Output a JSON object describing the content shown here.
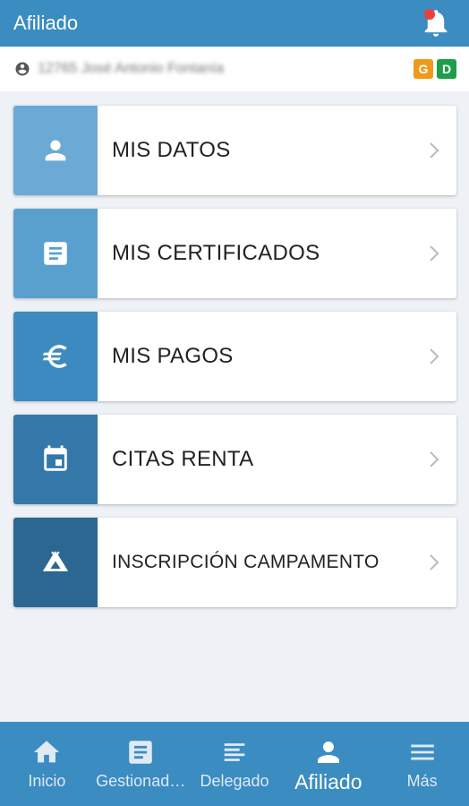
{
  "appbar": {
    "title": "Afiliado"
  },
  "user": {
    "name": "12765 José Antonio Fontanía",
    "badges": [
      "G",
      "D"
    ]
  },
  "menu": [
    {
      "label": "MIS DATOS",
      "icon": "person-icon",
      "color": "#6baad4"
    },
    {
      "label": "MIS CERTIFICADOS",
      "icon": "document-icon",
      "color": "#5aa0cf"
    },
    {
      "label": "MIS PAGOS",
      "icon": "euro-icon",
      "color": "#3d8ac0"
    },
    {
      "label": "CITAS RENTA",
      "icon": "calendar-icon",
      "color": "#3378a9"
    },
    {
      "label": "INSCRIPCIÓN CAMPAMENTO",
      "icon": "tent-icon",
      "color": "#2c6791"
    }
  ],
  "nav": [
    {
      "label": "Inicio",
      "icon": "home-icon"
    },
    {
      "label": "Gestionad…",
      "icon": "document-icon"
    },
    {
      "label": "Delegado",
      "icon": "lines-icon"
    },
    {
      "label": "Afiliado",
      "icon": "person-icon",
      "active": true
    },
    {
      "label": "Más",
      "icon": "menu-icon"
    }
  ],
  "colors": {
    "primary": "#3a8cc1",
    "background": "#eef1f5",
    "notification": "#e8433a"
  }
}
